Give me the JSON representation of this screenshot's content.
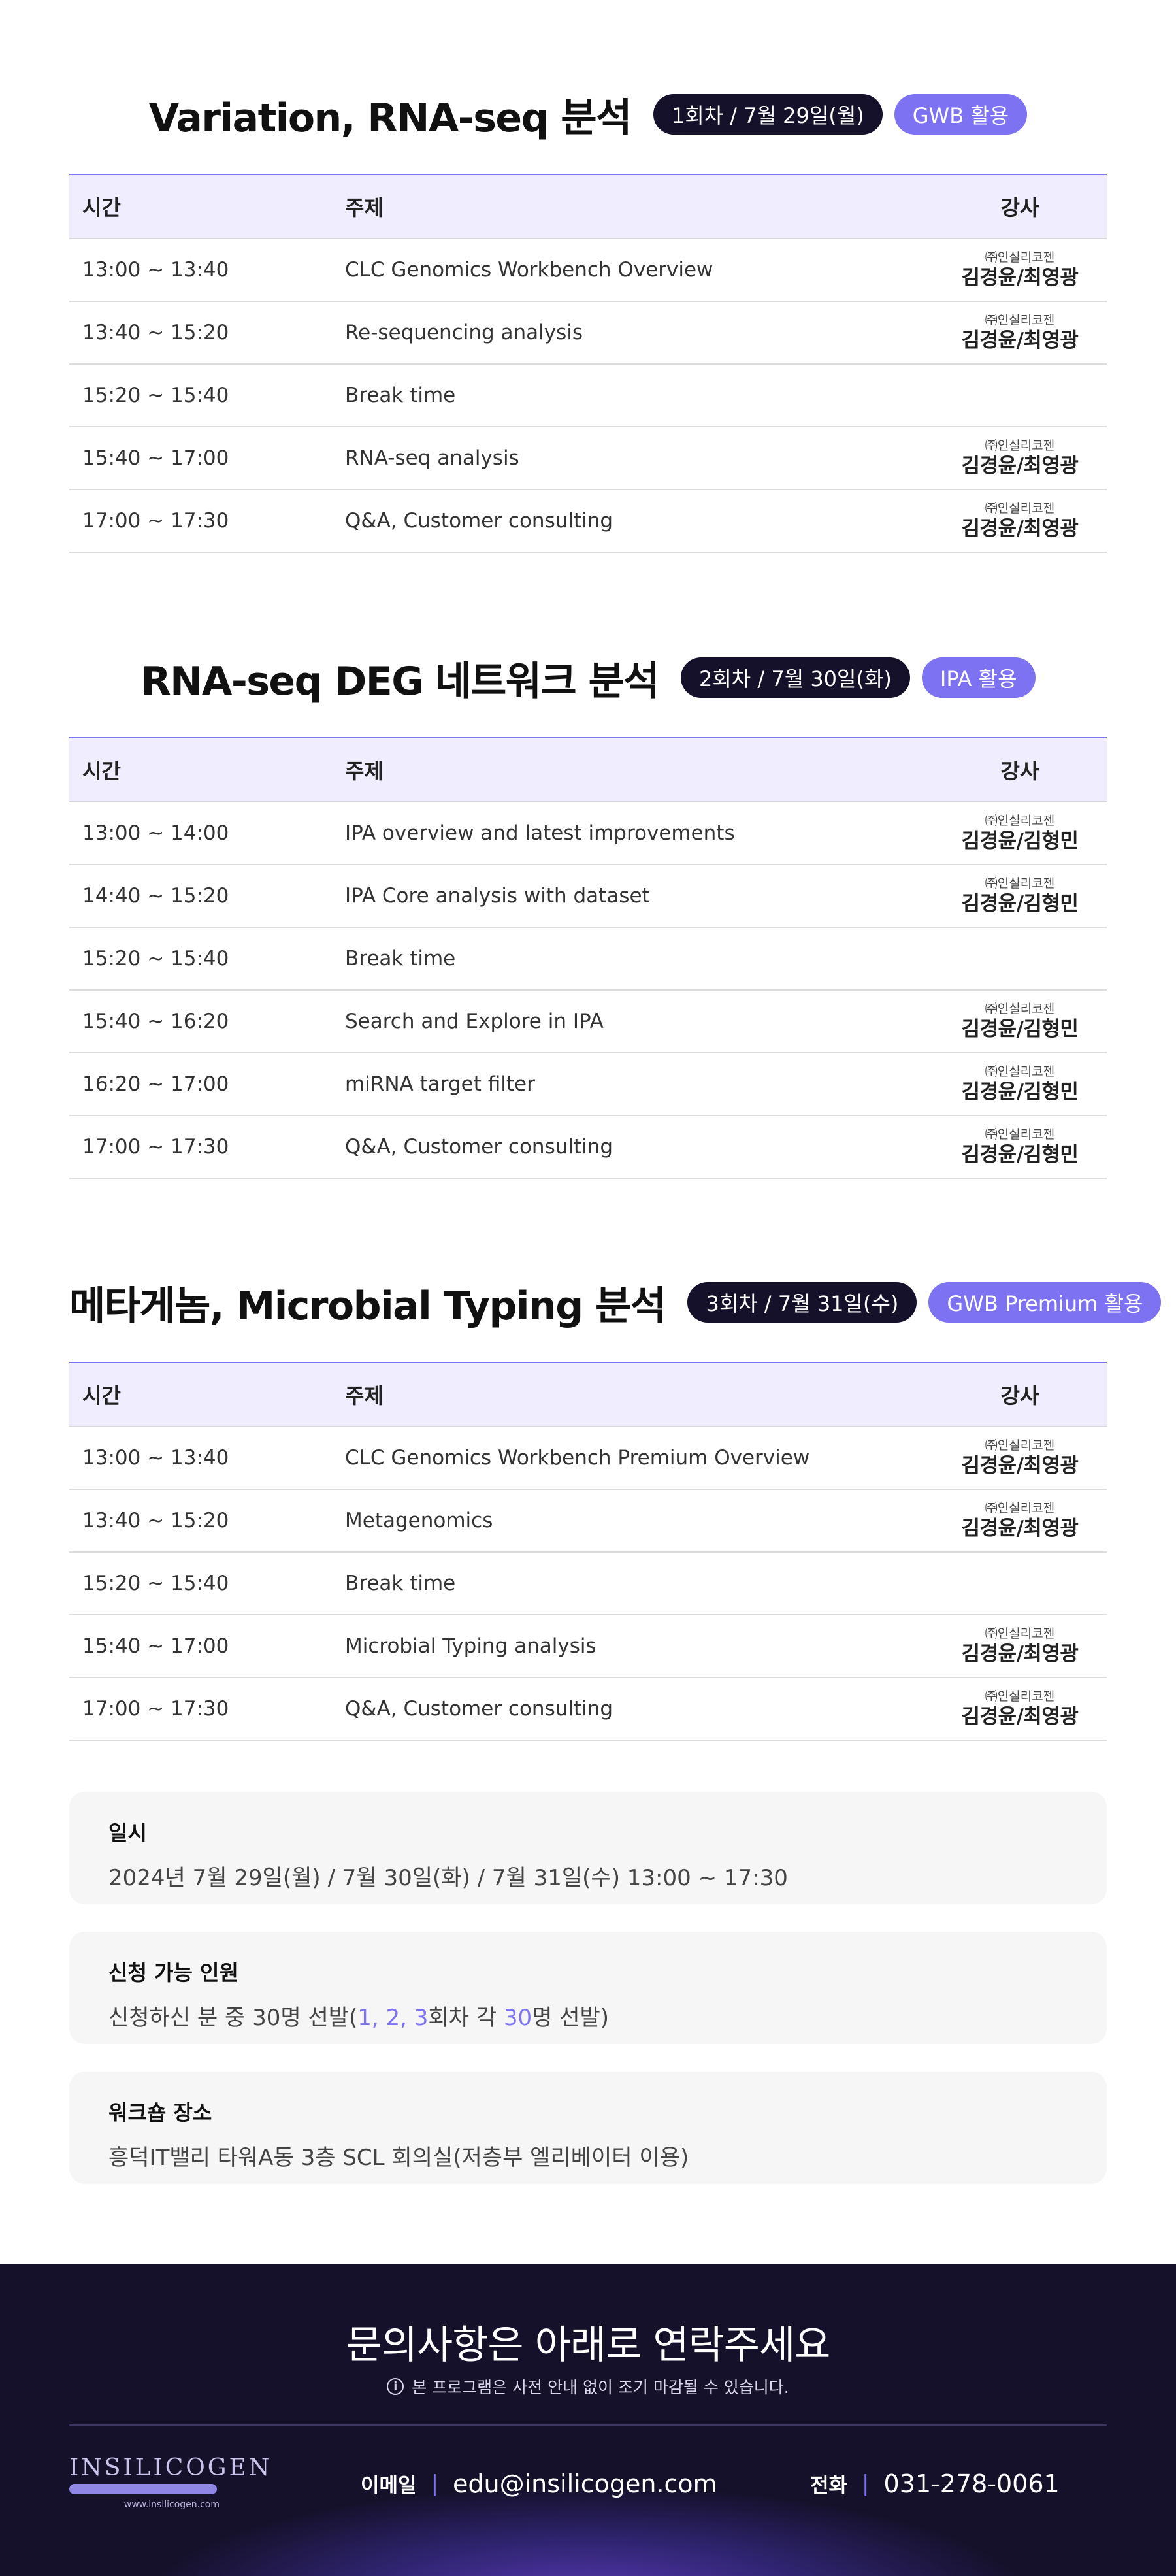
{
  "table_headers": {
    "time": "시간",
    "topic": "주제",
    "instructor": "강사"
  },
  "sessions": [
    {
      "title": "Variation, RNA-seq 분석",
      "badge_round": "1회차 / 7월 29일(월)",
      "badge_tool": "GWB 활용",
      "rows": [
        {
          "time": "13:00 ~ 13:40",
          "topic": "CLC Genomics Workbench Overview",
          "company": "㈜인실리코젠",
          "instructor": "김경윤/최영광"
        },
        {
          "time": "13:40 ~ 15:20",
          "topic": "Re-sequencing analysis",
          "company": "㈜인실리코젠",
          "instructor": "김경윤/최영광"
        },
        {
          "time": "15:20 ~ 15:40",
          "topic": "Break time",
          "company": "",
          "instructor": ""
        },
        {
          "time": "15:40 ~ 17:00",
          "topic": "RNA-seq analysis",
          "company": "㈜인실리코젠",
          "instructor": "김경윤/최영광"
        },
        {
          "time": "17:00 ~ 17:30",
          "topic": "Q&A, Customer consulting",
          "company": "㈜인실리코젠",
          "instructor": "김경윤/최영광"
        }
      ]
    },
    {
      "title": "RNA-seq DEG 네트워크 분석",
      "badge_round": "2회차 / 7월 30일(화)",
      "badge_tool": "IPA 활용",
      "rows": [
        {
          "time": "13:00 ~ 14:00",
          "topic": "IPA overview and latest improvements",
          "company": "㈜인실리코젠",
          "instructor": "김경윤/김형민"
        },
        {
          "time": "14:40 ~ 15:20",
          "topic": "IPA Core analysis with dataset",
          "company": "㈜인실리코젠",
          "instructor": "김경윤/김형민"
        },
        {
          "time": "15:20 ~ 15:40",
          "topic": "Break time",
          "company": "",
          "instructor": ""
        },
        {
          "time": "15:40 ~ 16:20",
          "topic": "Search and Explore in IPA",
          "company": "㈜인실리코젠",
          "instructor": "김경윤/김형민"
        },
        {
          "time": "16:20 ~ 17:00",
          "topic": "miRNA target filter",
          "company": "㈜인실리코젠",
          "instructor": "김경윤/김형민"
        },
        {
          "time": "17:00 ~ 17:30",
          "topic": "Q&A, Customer consulting",
          "company": "㈜인실리코젠",
          "instructor": "김경윤/김형민"
        }
      ]
    },
    {
      "title": "메타게놈, Microbial Typing 분석",
      "badge_round": "3회차 / 7월 31일(수)",
      "badge_tool": "GWB Premium 활용",
      "rows": [
        {
          "time": "13:00 ~ 13:40",
          "topic": "CLC Genomics Workbench Premium Overview",
          "company": "㈜인실리코젠",
          "instructor": "김경윤/최영광"
        },
        {
          "time": "13:40 ~ 15:20",
          "topic": "Metagenomics",
          "company": "㈜인실리코젠",
          "instructor": "김경윤/최영광"
        },
        {
          "time": "15:20 ~ 15:40",
          "topic": "Break time",
          "company": "",
          "instructor": ""
        },
        {
          "time": "15:40 ~ 17:00",
          "topic": "Microbial Typing analysis",
          "company": "㈜인실리코젠",
          "instructor": "김경윤/최영광"
        },
        {
          "time": "17:00 ~ 17:30",
          "topic": "Q&A, Customer consulting",
          "company": "㈜인실리코젠",
          "instructor": "김경윤/최영광"
        }
      ]
    }
  ],
  "info": {
    "date_label": "일시",
    "date_value": "2024년 7월 29일(월) / 7월 30일(화) / 7월 31일(수)  13:00 ~ 17:30",
    "capacity_label": "신청 가능 인원",
    "capacity_prefix": "신청하신 분 중 30명 선발(",
    "capacity_rounds": "1, 2, 3",
    "capacity_mid": "회차 각 ",
    "capacity_count": "30",
    "capacity_suffix": "명 선발)",
    "place_label": "워크숍 장소",
    "place_value": "흥덕IT밸리 타워A동 3층 SCL 회의실(저층부 엘리베이터 이용)"
  },
  "footer": {
    "title": "문의사항은 아래로 연락주세요",
    "note": "본 프로그램은 사전 안내 없이 조기 마감될 수 있습니다.",
    "logo_text": "INSILICOGEN",
    "logo_url": "www.insilicogen.com",
    "email_label": "이메일",
    "email": "edu@insilicogen.com",
    "phone_label": "전화",
    "phone": "031-278-0061"
  },
  "colors": {
    "accent": "#7d72f1",
    "dark": "#15112b",
    "header_bg": "#f0eefe",
    "info_bg": "#f6f6f6"
  }
}
